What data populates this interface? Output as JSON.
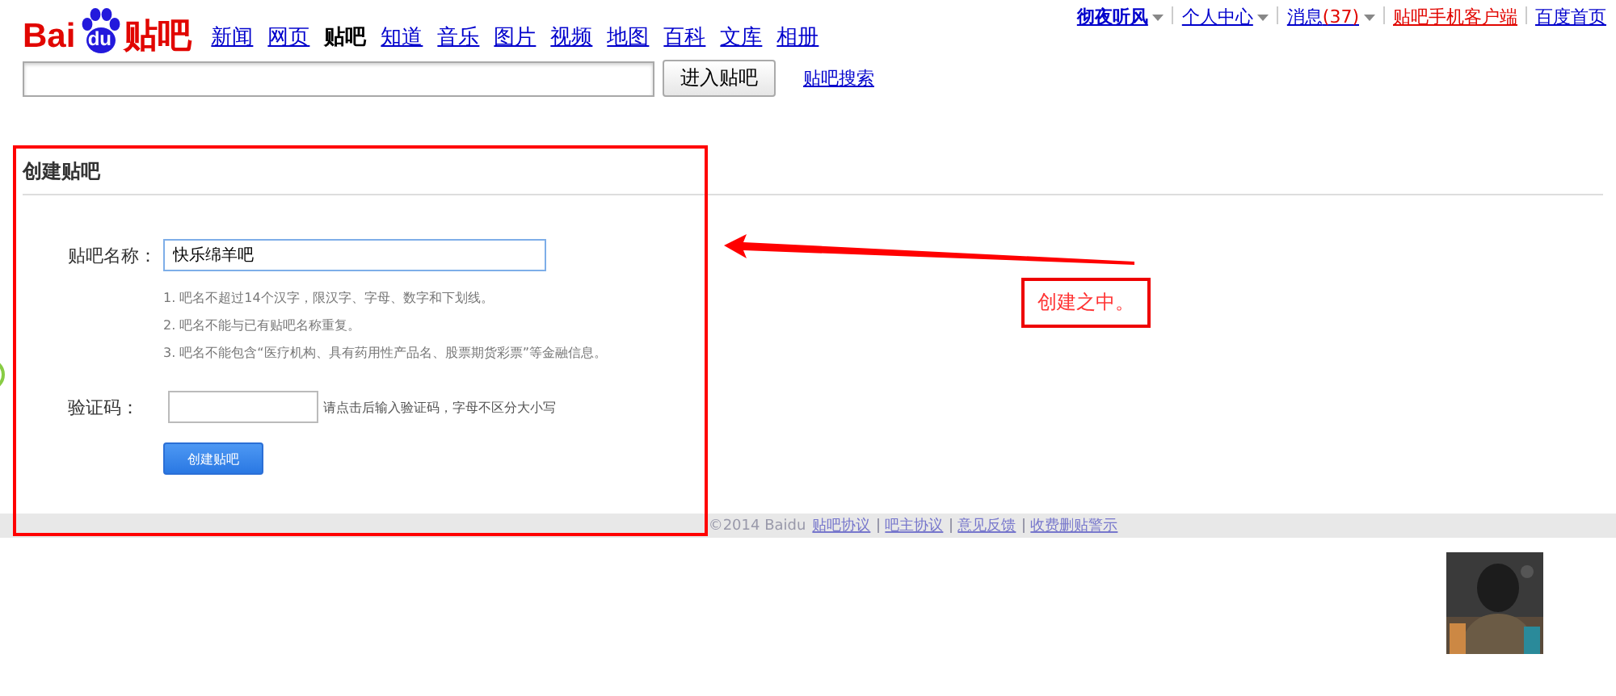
{
  "logo": {
    "brand": "Bai",
    "paw": "du",
    "product": "贴吧"
  },
  "nav": [
    {
      "label": "新闻",
      "selected": false
    },
    {
      "label": "网页",
      "selected": false
    },
    {
      "label": "贴吧",
      "selected": true
    },
    {
      "label": "知道",
      "selected": false
    },
    {
      "label": "音乐",
      "selected": false
    },
    {
      "label": "图片",
      "selected": false
    },
    {
      "label": "视频",
      "selected": false
    },
    {
      "label": "地图",
      "selected": false
    },
    {
      "label": "百科",
      "selected": false
    },
    {
      "label": "文库",
      "selected": false
    },
    {
      "label": "相册",
      "selected": false
    }
  ],
  "user_menu": [
    {
      "kind": "user",
      "label": "彻夜听风",
      "dropdown": true
    },
    {
      "kind": "link",
      "label": "个人中心",
      "dropdown": true
    },
    {
      "kind": "link",
      "label": "消息",
      "count": "(37)",
      "dropdown": true
    },
    {
      "kind": "promo",
      "label": "贴吧手机客户端",
      "dropdown": false
    },
    {
      "kind": "link",
      "label": "百度首页",
      "dropdown": false
    }
  ],
  "search": {
    "button": "进入贴吧",
    "link": "贴吧搜索"
  },
  "create": {
    "title": "创建贴吧",
    "name_label": "贴吧名称：",
    "name_value": "快乐绵羊吧",
    "rules": [
      "1. 吧名不超过14个汉字，限汉字、字母、数字和下划线。",
      "2. 吧名不能与已有贴吧名称重复。",
      "3. 吧名不能包含“医疗机构、具有药用性产品名、股票期货彩票”等金融信息。"
    ],
    "captcha_label": "验证码：",
    "captcha_hint": "请点击后输入验证码，字母不区分大小写",
    "submit": "创建贴吧"
  },
  "footer": {
    "copyright": "©2014 Baidu",
    "links": [
      "贴吧协议",
      "吧主协议",
      "意见反馈",
      "收费删贴警示"
    ]
  },
  "annotation": {
    "callout": "创建之中。"
  }
}
